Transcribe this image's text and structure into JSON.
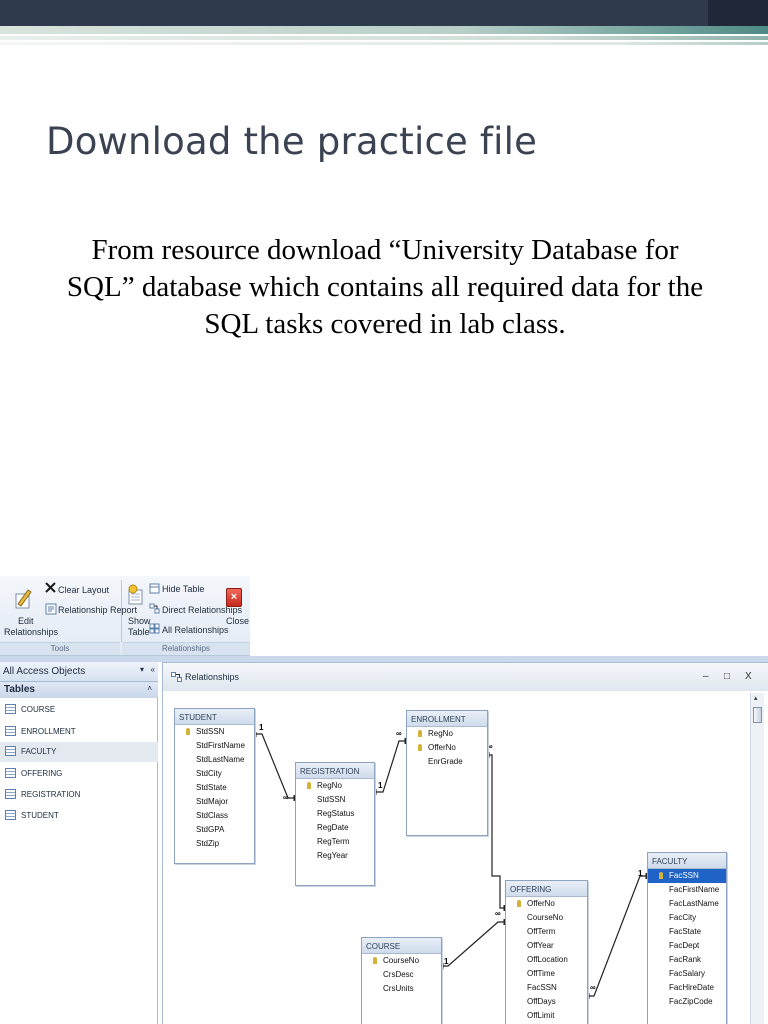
{
  "slide": {
    "title": "Download the practice file",
    "body": "From resource download “University Database for SQL” database which contains all required data for the SQL tasks covered in lab class."
  },
  "ribbon": {
    "clear_layout": "Clear Layout",
    "relationship_report": "Relationship Report",
    "edit_relationships_1": "Edit",
    "edit_relationships_2": "Relationships",
    "show_table_1": "Show",
    "show_table_2": "Table",
    "hide_table": "Hide Table",
    "direct_relationships": "Direct Relationships",
    "all_relationships": "All Relationships",
    "close": "Close",
    "group_tools": "Tools",
    "group_relationships": "Relationships"
  },
  "nav": {
    "header": "All Access Objects",
    "section": "Tables",
    "items": [
      "COURSE",
      "ENROLLMENT",
      "FACULTY",
      "OFFERING",
      "REGISTRATION",
      "STUDENT"
    ]
  },
  "window": {
    "title": "Relationships",
    "minimize": "–",
    "restore": "□",
    "close": "X"
  },
  "tables": {
    "student": {
      "name": "STUDENT",
      "fields": [
        "StdSSN",
        "StdFirstName",
        "StdLastName",
        "StdCity",
        "StdState",
        "StdMajor",
        "StdClass",
        "StdGPA",
        "StdZip"
      ]
    },
    "registration": {
      "name": "REGISTRATION",
      "fields": [
        "RegNo",
        "StdSSN",
        "RegStatus",
        "RegDate",
        "RegTerm",
        "RegYear"
      ]
    },
    "enrollment": {
      "name": "ENROLLMENT",
      "fields": [
        "RegNo",
        "OfferNo",
        "EnrGrade"
      ]
    },
    "offering": {
      "name": "OFFERING",
      "fields": [
        "OfferNo",
        "CourseNo",
        "OffTerm",
        "OffYear",
        "OffLocation",
        "OffTime",
        "FacSSN",
        "OffDays",
        "OffLimit"
      ]
    },
    "course": {
      "name": "COURSE",
      "fields": [
        "CourseNo",
        "CrsDesc",
        "CrsUnits"
      ]
    },
    "faculty": {
      "name": "FACULTY",
      "fields": [
        "FacSSN",
        "FacFirstName",
        "FacLastName",
        "FacCity",
        "FacState",
        "FacDept",
        "FacRank",
        "FacSalary",
        "FacHireDate",
        "FacZipCode"
      ]
    }
  },
  "cardinality": {
    "one": "1",
    "many": "∞"
  }
}
